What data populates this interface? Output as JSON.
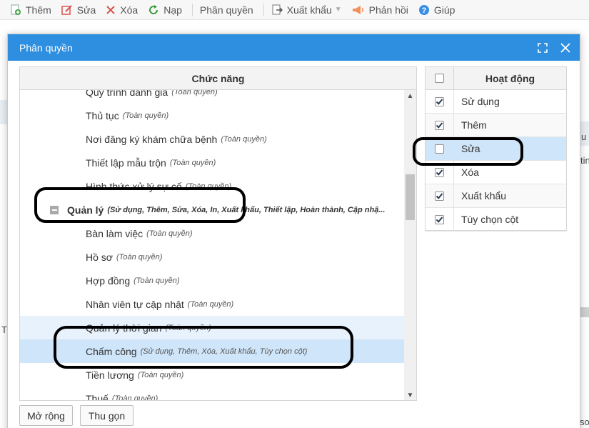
{
  "toolbar": {
    "add": "Thêm",
    "edit": "Sửa",
    "delete": "Xóa",
    "reload": "Nạp",
    "permission": "Phân quyền",
    "export": "Xuất khẩu",
    "feedback": "Phản hồi",
    "help": "Giúp"
  },
  "dialog": {
    "title": "Phân quyền",
    "left_header": "Chức năng",
    "right_header": "Hoạt động",
    "tree": [
      {
        "label": "Quy trình đánh giá",
        "perm": "(Toàn quyền)",
        "level": 2,
        "state": ""
      },
      {
        "label": "Thủ tục",
        "perm": "(Toàn quyền)",
        "level": 2,
        "state": ""
      },
      {
        "label": "Nơi đăng ký khám chữa bệnh",
        "perm": "(Toàn quyền)",
        "level": 2,
        "state": ""
      },
      {
        "label": "Thiết lập mẫu trộn",
        "perm": "(Toàn quyền)",
        "level": 2,
        "state": ""
      },
      {
        "label": "Hình thức xử lý sự cố",
        "perm": "(Toàn quyền)",
        "level": 2,
        "state": ""
      },
      {
        "label": "Quản lý",
        "perm": "(Sử dụng, Thêm, Sửa, Xóa, In, Xuất khẩu, Thiết lập, Hoàn thành, Cập nhậ...",
        "level": 1,
        "state": ""
      },
      {
        "label": "Bàn làm việc",
        "perm": "(Toàn quyền)",
        "level": 2,
        "state": ""
      },
      {
        "label": "Hồ sơ",
        "perm": "(Toàn quyền)",
        "level": 2,
        "state": ""
      },
      {
        "label": "Hợp đồng",
        "perm": "(Toàn quyền)",
        "level": 2,
        "state": ""
      },
      {
        "label": "Nhân viên tự cập nhật",
        "perm": "(Toàn quyền)",
        "level": 2,
        "state": ""
      },
      {
        "label": "Quản lý thời gian",
        "perm": "(Toàn quyền)",
        "level": 2,
        "state": "hover"
      },
      {
        "label": "Chấm công",
        "perm": "(Sử dụng, Thêm, Xóa, Xuất khẩu, Tùy chọn cột)",
        "level": 2,
        "state": "selected"
      },
      {
        "label": "Tiền lương",
        "perm": "(Toàn quyền)",
        "level": 2,
        "state": ""
      },
      {
        "label": "Thuế",
        "perm": "(Toàn quyền)",
        "level": 2,
        "state": ""
      }
    ],
    "actions": [
      {
        "label": "Sử dụng",
        "checked": true,
        "state": ""
      },
      {
        "label": "Thêm",
        "checked": true,
        "state": "alt"
      },
      {
        "label": "Sửa",
        "checked": false,
        "state": "hl"
      },
      {
        "label": "Xóa",
        "checked": true,
        "state": ""
      },
      {
        "label": "Xuất khẩu",
        "checked": true,
        "state": "alt"
      },
      {
        "label": "Tùy chọn cột",
        "checked": true,
        "state": ""
      }
    ],
    "expand_button": "Mở rộng",
    "collapse_button": "Thu gọn"
  },
  "background": {
    "right_fragment_1": "u tr",
    "right_fragment_2": "tin",
    "left_fragment": "T",
    "bottom_right_fragment": "so"
  },
  "colors": {
    "title_bar": "#2e8fe0",
    "selected_row": "#cfe5f9",
    "hover_row": "#e8f2fc"
  }
}
